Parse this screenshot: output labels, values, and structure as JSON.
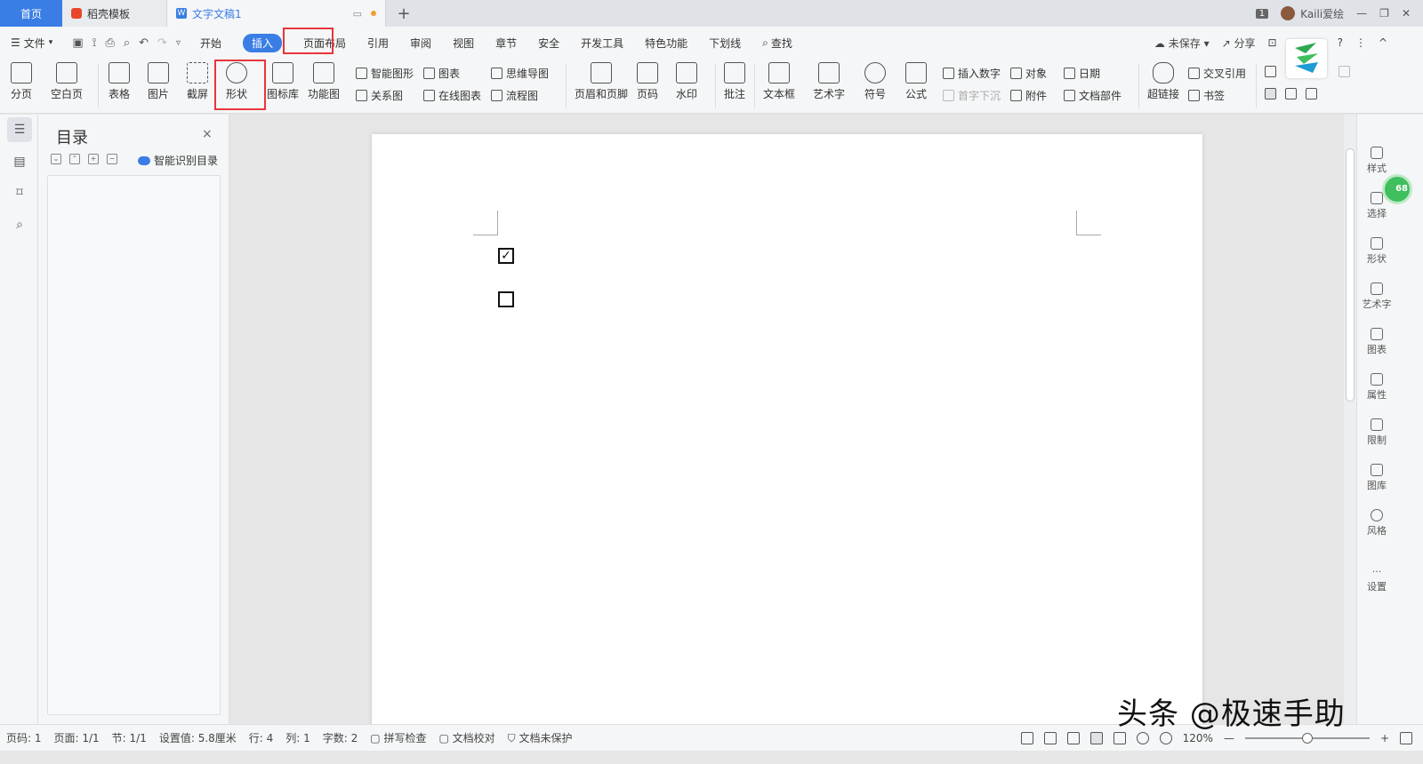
{
  "titlebar": {
    "home_tab": "首页",
    "template_tab": "稻壳模板",
    "doc_tab": "文字文稿1",
    "new_tab": "+",
    "badge": "1",
    "user": "Kaili爱绘",
    "win_min": "—",
    "win_restore": "❐",
    "win_close": "✕"
  },
  "menubar": {
    "file": "文件",
    "tabs": [
      "开始",
      "插入",
      "页面布局",
      "引用",
      "审阅",
      "视图",
      "章节",
      "安全",
      "开发工具",
      "特色功能",
      "下划线"
    ],
    "search": "查找",
    "unsaved": "未保存",
    "share": "分享",
    "help": "?",
    "more": "⋮",
    "collapse": "^"
  },
  "ribbon": {
    "page_break": "分页",
    "blank_page": "空白页",
    "table": "表格",
    "picture": "图片",
    "screenshot": "截屏",
    "shape": "形状",
    "icon_lib": "图标库",
    "func_chart": "功能图",
    "smart_art": "智能图形",
    "chart": "图表",
    "mindmap": "思维导图",
    "relation": "关系图",
    "online_chart": "在线图表",
    "flowchart": "流程图",
    "header_footer": "页眉和页脚",
    "page_num": "页码",
    "watermark": "水印",
    "comment": "批注",
    "textbox": "文本框",
    "wordart": "艺术字",
    "symbol": "符号",
    "formula": "公式",
    "insert_num": "插入数字",
    "object": "对象",
    "date": "日期",
    "dropcap": "首字下沉",
    "attachment": "附件",
    "doc_part": "文档部件",
    "hyperlink": "超链接",
    "crossref": "交叉引用",
    "bookmark": "书签"
  },
  "toc": {
    "title": "目录",
    "close": "×",
    "smart": "智能识别目录"
  },
  "document": {
    "checked": "✓",
    "unchecked": ""
  },
  "rightpanel": {
    "items": [
      "样式",
      "选择",
      "形状",
      "艺术字",
      "图表",
      "属性",
      "限制",
      "图库",
      "风格",
      "设置"
    ],
    "bubble": "68"
  },
  "statusbar": {
    "page_code": "页码: 1",
    "page": "页面: 1/1",
    "section": "节: 1/1",
    "setting": "设置值: 5.8厘米",
    "row": "行: 4",
    "col": "列: 1",
    "words": "字数: 2",
    "spell": "拼写检查",
    "proof": "文档校对",
    "protect": "文档未保护",
    "zoom": "120%",
    "zoom_minus": "—",
    "zoom_plus": "+"
  },
  "overlay": {
    "watermark": "头条 @极速手助"
  },
  "colors": {
    "accent": "#3a7ee5",
    "highlight": "#e8353b"
  }
}
